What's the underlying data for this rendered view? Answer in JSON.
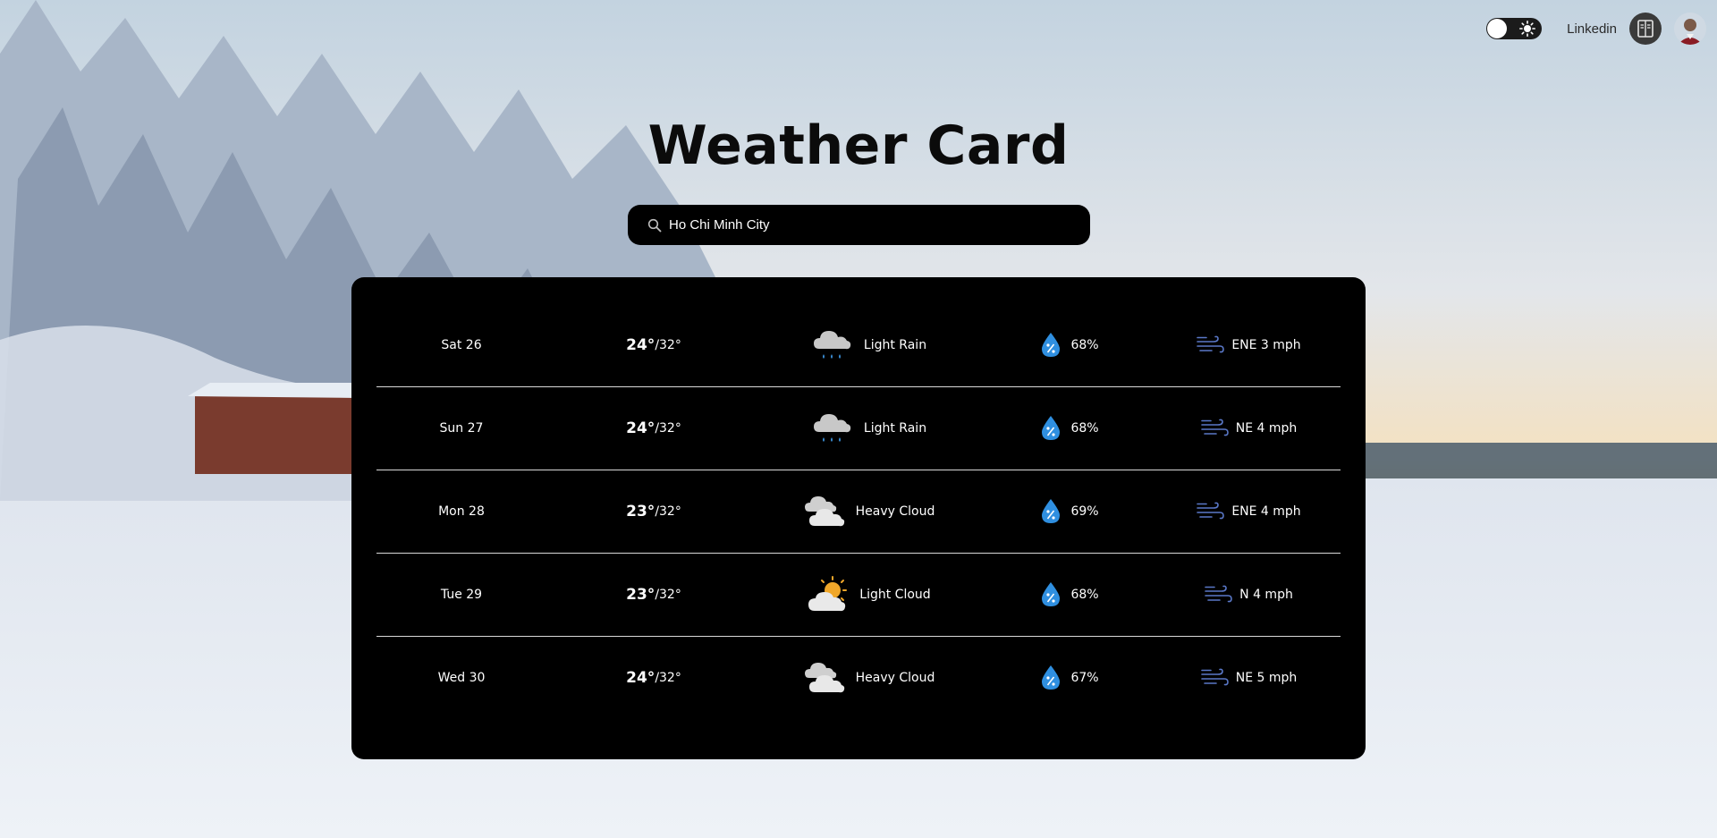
{
  "theme": {
    "card_background": "#000000",
    "title_color": "#0b0b0b",
    "drop_color": "#2f8fe0",
    "wind_icon_color": "#5a78c8",
    "divider_color": "#d9d9d9"
  },
  "header": {
    "theme_toggle": {
      "state": "light",
      "icon": "sun-icon"
    },
    "linkedin_label": "Linkedin",
    "icon_button": "book-icon",
    "avatar": "user-avatar"
  },
  "main": {
    "title": "Weather Card",
    "search": {
      "icon": "search-icon",
      "value": "Ho Chi Minh City"
    }
  },
  "forecast": [
    {
      "day": "Sat 26",
      "high": "24°",
      "low": "/32°",
      "condition": "Light Rain",
      "icon": "rain-cloud-icon",
      "humidity": "68%",
      "wind": "ENE 3 mph"
    },
    {
      "day": "Sun 27",
      "high": "24°",
      "low": "/32°",
      "condition": "Light Rain",
      "icon": "rain-cloud-icon",
      "humidity": "68%",
      "wind": "NE 4 mph"
    },
    {
      "day": "Mon 28",
      "high": "23°",
      "low": "/32°",
      "condition": "Heavy Cloud",
      "icon": "heavy-cloud-icon",
      "humidity": "69%",
      "wind": "ENE 4 mph"
    },
    {
      "day": "Tue 29",
      "high": "23°",
      "low": "/32°",
      "condition": "Light Cloud",
      "icon": "sun-cloud-icon",
      "humidity": "68%",
      "wind": "N 4 mph"
    },
    {
      "day": "Wed 30",
      "high": "24°",
      "low": "/32°",
      "condition": "Heavy Cloud",
      "icon": "heavy-cloud-icon",
      "humidity": "67%",
      "wind": "NE 5 mph"
    }
  ]
}
